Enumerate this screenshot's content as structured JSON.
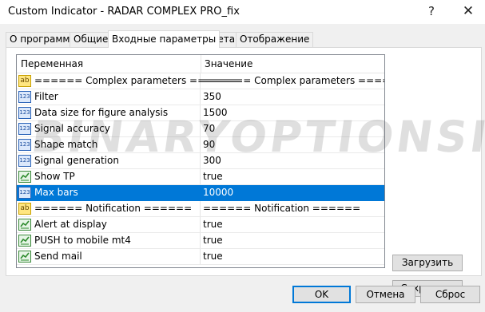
{
  "window": {
    "title": "Custom Indicator - RADAR COMPLEX PRO_fix",
    "help_glyph": "?",
    "close_glyph": "✕"
  },
  "tabs": [
    {
      "label": "О программе",
      "active": false
    },
    {
      "label": "Общие",
      "active": false
    },
    {
      "label": "Входные параметры",
      "active": true
    },
    {
      "label": "Цвета",
      "active": false
    },
    {
      "label": "Отображение",
      "active": false
    }
  ],
  "grid": {
    "header": {
      "variable": "Переменная",
      "value": "Значение"
    },
    "rows": [
      {
        "icon": "string-icon",
        "name": "====== Complex parameters ======",
        "value": "====== Complex parameters ======"
      },
      {
        "icon": "number-icon",
        "name": "Filter",
        "value": "350"
      },
      {
        "icon": "number-icon",
        "name": "Data size for figure analysis",
        "value": "1500"
      },
      {
        "icon": "number-icon",
        "name": "Signal accuracy",
        "value": "70"
      },
      {
        "icon": "number-icon",
        "name": "Shape match",
        "value": "90"
      },
      {
        "icon": "number-icon",
        "name": "Signal generation",
        "value": "300"
      },
      {
        "icon": "bool-icon",
        "name": "Show TP",
        "value": "true"
      },
      {
        "icon": "number-icon",
        "name": "Max bars",
        "value": "10000",
        "selected": true
      },
      {
        "icon": "string-icon",
        "name": "====== Notification ======",
        "value": "====== Notification ======"
      },
      {
        "icon": "bool-icon",
        "name": "Alert at display",
        "value": "true"
      },
      {
        "icon": "bool-icon",
        "name": "PUSH to mobile mt4",
        "value": "true"
      },
      {
        "icon": "bool-icon",
        "name": "Send mail",
        "value": "true"
      }
    ],
    "icon_text": {
      "string": "ab",
      "number": "123"
    }
  },
  "side_buttons": {
    "load": "Загрузить",
    "save": "Сохранить"
  },
  "buttons": {
    "ok": "OK",
    "cancel": "Отмена",
    "reset": "Сброс"
  },
  "watermark": "BINARYOPTIONSIGNALS.COM",
  "colors": {
    "selection": "#0078d7",
    "ok_border": "#0078d7"
  }
}
